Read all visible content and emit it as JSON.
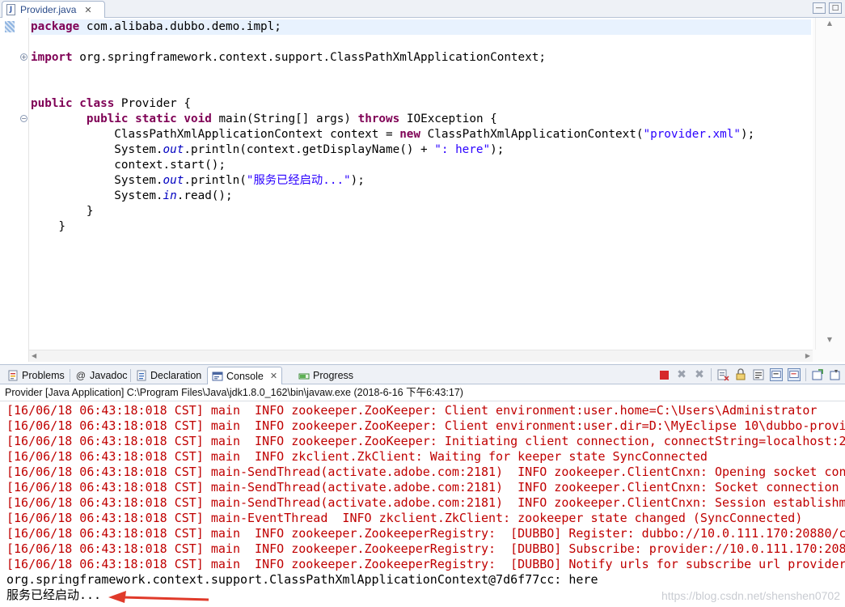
{
  "editor": {
    "tab_title": "Provider.java",
    "code_lines": [
      [
        {
          "k": "kw",
          "t": "package"
        },
        {
          "k": "",
          "t": " com.alibaba.dubbo.demo.impl;"
        }
      ],
      [],
      [
        {
          "k": "kw",
          "t": "import"
        },
        {
          "k": "",
          "t": " org.springframework.context.support.ClassPathXmlApplicationContext;"
        }
      ],
      [],
      [],
      [
        {
          "k": "kw",
          "t": "public"
        },
        {
          "k": "",
          "t": " "
        },
        {
          "k": "kw",
          "t": "class"
        },
        {
          "k": "",
          "t": " Provider {"
        }
      ],
      [
        {
          "k": "",
          "t": "        "
        },
        {
          "k": "kw",
          "t": "public"
        },
        {
          "k": "",
          "t": " "
        },
        {
          "k": "kw",
          "t": "static"
        },
        {
          "k": "",
          "t": " "
        },
        {
          "k": "kw",
          "t": "void"
        },
        {
          "k": "",
          "t": " main(String[] args) "
        },
        {
          "k": "kw",
          "t": "throws"
        },
        {
          "k": "",
          "t": " IOException {"
        }
      ],
      [
        {
          "k": "",
          "t": "            ClassPathXmlApplicationContext context = "
        },
        {
          "k": "kw",
          "t": "new"
        },
        {
          "k": "",
          "t": " ClassPathXmlApplicationContext("
        },
        {
          "k": "str",
          "t": "\"provider.xml\""
        },
        {
          "k": "",
          "t": ");"
        }
      ],
      [
        {
          "k": "",
          "t": "            System."
        },
        {
          "k": "ital",
          "t": "out"
        },
        {
          "k": "",
          "t": ".println(context.getDisplayName() + "
        },
        {
          "k": "str",
          "t": "\": here\""
        },
        {
          "k": "",
          "t": ");"
        }
      ],
      [
        {
          "k": "",
          "t": "            context.start();"
        }
      ],
      [
        {
          "k": "",
          "t": "            System."
        },
        {
          "k": "ital",
          "t": "out"
        },
        {
          "k": "",
          "t": ".println("
        },
        {
          "k": "str",
          "t": "\"服务已经启动...\""
        },
        {
          "k": "",
          "t": ");"
        }
      ],
      [
        {
          "k": "",
          "t": "            System."
        },
        {
          "k": "ital",
          "t": "in"
        },
        {
          "k": "",
          "t": ".read();"
        }
      ],
      [
        {
          "k": "",
          "t": "        }"
        }
      ],
      [
        {
          "k": "",
          "t": "    }"
        }
      ]
    ]
  },
  "panel": {
    "tabs": [
      {
        "label": "Problems",
        "icon": "problems-icon"
      },
      {
        "label": "Javadoc",
        "icon": "javadoc-icon"
      },
      {
        "label": "Declaration",
        "icon": "declaration-icon"
      },
      {
        "label": "Console",
        "icon": "console-icon"
      },
      {
        "label": "Progress",
        "icon": "progress-icon"
      }
    ],
    "console_header": "Provider [Java Application] C:\\Program Files\\Java\\jdk1.8.0_162\\bin\\javaw.exe (2018-6-16 下午6:43:17)"
  },
  "console": {
    "lines": [
      {
        "err": true,
        "text": "[16/06/18 06:43:18:018 CST] main  INFO zookeeper.ZooKeeper: Client environment:user.home=C:\\Users\\Administrator"
      },
      {
        "err": true,
        "text": "[16/06/18 06:43:18:018 CST] main  INFO zookeeper.ZooKeeper: Client environment:user.dir=D:\\MyEclipse 10\\dubbo-provi"
      },
      {
        "err": true,
        "text": "[16/06/18 06:43:18:018 CST] main  INFO zookeeper.ZooKeeper: Initiating client connection, connectString=localhost:2"
      },
      {
        "err": true,
        "text": "[16/06/18 06:43:18:018 CST] main  INFO zkclient.ZkClient: Waiting for keeper state SyncConnected"
      },
      {
        "err": true,
        "text": "[16/06/18 06:43:18:018 CST] main-SendThread(activate.adobe.com:2181)  INFO zookeeper.ClientCnxn: Opening socket conn"
      },
      {
        "err": true,
        "text": "[16/06/18 06:43:18:018 CST] main-SendThread(activate.adobe.com:2181)  INFO zookeeper.ClientCnxn: Socket connection e"
      },
      {
        "err": true,
        "text": "[16/06/18 06:43:18:018 CST] main-SendThread(activate.adobe.com:2181)  INFO zookeeper.ClientCnxn: Session establishm"
      },
      {
        "err": true,
        "text": "[16/06/18 06:43:18:018 CST] main-EventThread  INFO zkclient.ZkClient: zookeeper state changed (SyncConnected)"
      },
      {
        "err": true,
        "text": "[16/06/18 06:43:18:018 CST] main  INFO zookeeper.ZookeeperRegistry:  [DUBBO] Register: dubbo://10.0.111.170:20880/co"
      },
      {
        "err": true,
        "text": "[16/06/18 06:43:18:018 CST] main  INFO zookeeper.ZookeeperRegistry:  [DUBBO] Subscribe: provider://10.0.111.170:2088"
      },
      {
        "err": true,
        "text": "[16/06/18 06:43:18:018 CST] main  INFO zookeeper.ZookeeperRegistry:  [DUBBO] Notify urls for subscribe url provider"
      },
      {
        "err": false,
        "text": "org.springframework.context.support.ClassPathXmlApplicationContext@7d6f77cc: here"
      },
      {
        "err": false,
        "text": "服务已经启动..."
      }
    ],
    "watermark": "https://blog.csdn.net/shenshen0702"
  },
  "colors": {
    "keyword": "#7f0055",
    "string": "#2a00ff",
    "static_field": "#0000c0",
    "console_stderr": "#c00000",
    "terminate_button": "#d6282a",
    "annotation_arrow": "#e03a2a"
  }
}
